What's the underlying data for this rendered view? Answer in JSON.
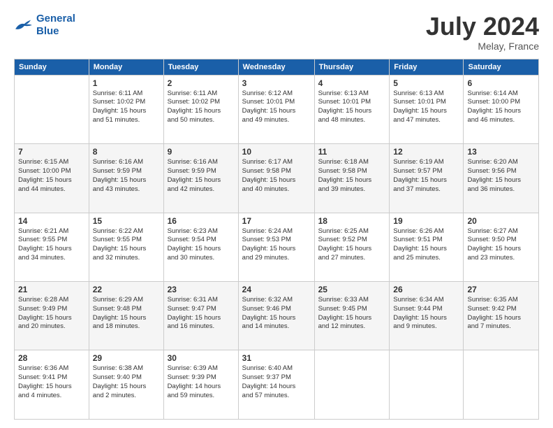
{
  "logo": {
    "line1": "General",
    "line2": "Blue"
  },
  "header": {
    "title": "July 2024",
    "location": "Melay, France"
  },
  "days_of_week": [
    "Sunday",
    "Monday",
    "Tuesday",
    "Wednesday",
    "Thursday",
    "Friday",
    "Saturday"
  ],
  "weeks": [
    [
      {
        "day": "",
        "info": ""
      },
      {
        "day": "1",
        "info": "Sunrise: 6:11 AM\nSunset: 10:02 PM\nDaylight: 15 hours\nand 51 minutes."
      },
      {
        "day": "2",
        "info": "Sunrise: 6:11 AM\nSunset: 10:02 PM\nDaylight: 15 hours\nand 50 minutes."
      },
      {
        "day": "3",
        "info": "Sunrise: 6:12 AM\nSunset: 10:01 PM\nDaylight: 15 hours\nand 49 minutes."
      },
      {
        "day": "4",
        "info": "Sunrise: 6:13 AM\nSunset: 10:01 PM\nDaylight: 15 hours\nand 48 minutes."
      },
      {
        "day": "5",
        "info": "Sunrise: 6:13 AM\nSunset: 10:01 PM\nDaylight: 15 hours\nand 47 minutes."
      },
      {
        "day": "6",
        "info": "Sunrise: 6:14 AM\nSunset: 10:00 PM\nDaylight: 15 hours\nand 46 minutes."
      }
    ],
    [
      {
        "day": "7",
        "info": "Sunrise: 6:15 AM\nSunset: 10:00 PM\nDaylight: 15 hours\nand 44 minutes."
      },
      {
        "day": "8",
        "info": "Sunrise: 6:16 AM\nSunset: 9:59 PM\nDaylight: 15 hours\nand 43 minutes."
      },
      {
        "day": "9",
        "info": "Sunrise: 6:16 AM\nSunset: 9:59 PM\nDaylight: 15 hours\nand 42 minutes."
      },
      {
        "day": "10",
        "info": "Sunrise: 6:17 AM\nSunset: 9:58 PM\nDaylight: 15 hours\nand 40 minutes."
      },
      {
        "day": "11",
        "info": "Sunrise: 6:18 AM\nSunset: 9:58 PM\nDaylight: 15 hours\nand 39 minutes."
      },
      {
        "day": "12",
        "info": "Sunrise: 6:19 AM\nSunset: 9:57 PM\nDaylight: 15 hours\nand 37 minutes."
      },
      {
        "day": "13",
        "info": "Sunrise: 6:20 AM\nSunset: 9:56 PM\nDaylight: 15 hours\nand 36 minutes."
      }
    ],
    [
      {
        "day": "14",
        "info": "Sunrise: 6:21 AM\nSunset: 9:55 PM\nDaylight: 15 hours\nand 34 minutes."
      },
      {
        "day": "15",
        "info": "Sunrise: 6:22 AM\nSunset: 9:55 PM\nDaylight: 15 hours\nand 32 minutes."
      },
      {
        "day": "16",
        "info": "Sunrise: 6:23 AM\nSunset: 9:54 PM\nDaylight: 15 hours\nand 30 minutes."
      },
      {
        "day": "17",
        "info": "Sunrise: 6:24 AM\nSunset: 9:53 PM\nDaylight: 15 hours\nand 29 minutes."
      },
      {
        "day": "18",
        "info": "Sunrise: 6:25 AM\nSunset: 9:52 PM\nDaylight: 15 hours\nand 27 minutes."
      },
      {
        "day": "19",
        "info": "Sunrise: 6:26 AM\nSunset: 9:51 PM\nDaylight: 15 hours\nand 25 minutes."
      },
      {
        "day": "20",
        "info": "Sunrise: 6:27 AM\nSunset: 9:50 PM\nDaylight: 15 hours\nand 23 minutes."
      }
    ],
    [
      {
        "day": "21",
        "info": "Sunrise: 6:28 AM\nSunset: 9:49 PM\nDaylight: 15 hours\nand 20 minutes."
      },
      {
        "day": "22",
        "info": "Sunrise: 6:29 AM\nSunset: 9:48 PM\nDaylight: 15 hours\nand 18 minutes."
      },
      {
        "day": "23",
        "info": "Sunrise: 6:31 AM\nSunset: 9:47 PM\nDaylight: 15 hours\nand 16 minutes."
      },
      {
        "day": "24",
        "info": "Sunrise: 6:32 AM\nSunset: 9:46 PM\nDaylight: 15 hours\nand 14 minutes."
      },
      {
        "day": "25",
        "info": "Sunrise: 6:33 AM\nSunset: 9:45 PM\nDaylight: 15 hours\nand 12 minutes."
      },
      {
        "day": "26",
        "info": "Sunrise: 6:34 AM\nSunset: 9:44 PM\nDaylight: 15 hours\nand 9 minutes."
      },
      {
        "day": "27",
        "info": "Sunrise: 6:35 AM\nSunset: 9:42 PM\nDaylight: 15 hours\nand 7 minutes."
      }
    ],
    [
      {
        "day": "28",
        "info": "Sunrise: 6:36 AM\nSunset: 9:41 PM\nDaylight: 15 hours\nand 4 minutes."
      },
      {
        "day": "29",
        "info": "Sunrise: 6:38 AM\nSunset: 9:40 PM\nDaylight: 15 hours\nand 2 minutes."
      },
      {
        "day": "30",
        "info": "Sunrise: 6:39 AM\nSunset: 9:39 PM\nDaylight: 14 hours\nand 59 minutes."
      },
      {
        "day": "31",
        "info": "Sunrise: 6:40 AM\nSunset: 9:37 PM\nDaylight: 14 hours\nand 57 minutes."
      },
      {
        "day": "",
        "info": ""
      },
      {
        "day": "",
        "info": ""
      },
      {
        "day": "",
        "info": ""
      }
    ]
  ]
}
